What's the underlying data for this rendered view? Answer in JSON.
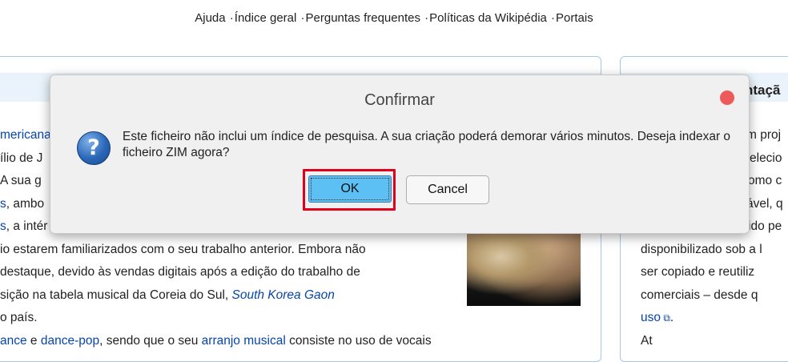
{
  "topnav": {
    "links": [
      "Ajuda",
      "Índice geral",
      "Perguntas frequentes",
      "Políticas da Wikipédia",
      "Portais"
    ],
    "separator": "·"
  },
  "right_box": {
    "heading": "ntaçã",
    "lines": [
      "m proj",
      "elecio",
      "omo c",
      "ável, q",
      "ido pe",
      "disponibilizado sob a l",
      "ser copiado e reutiliz",
      "comerciais – desde q",
      "uso",
      "At"
    ]
  },
  "article": {
    "l1": "mericana",
    "l2": "ílio de J",
    "l3": " A sua g",
    "l4_link": "s",
    "l4_text": ", ambo",
    "l5_link": "s",
    "l5_text": ", a intér",
    "l6": "io estarem familiarizados com o seu trabalho anterior. Embora não",
    "l7": "destaque, devido às vendas digitais após a edição do trabalho de",
    "l8_text": "sição na tabela musical da Coreia do Sul, ",
    "l8_link": "South Korea Gaon",
    "l9": "o país.",
    "l10_link1": "ance",
    "l10_text1": " e ",
    "l10_link2": "dance-pop",
    "l10_text2": ", sendo que o seu ",
    "l10_link3": "arranjo musical",
    "l10_text3": " consiste no uso de vocais"
  },
  "dialog": {
    "title": "Confirmar",
    "message": "Este ficheiro não inclui um índice de pesquisa. A sua criação poderá demorar vários minutos. Deseja indexar o ficheiro ZIM agora?",
    "icon": "question-icon",
    "ok_label": "OK",
    "cancel_label": "Cancel",
    "highlight_color": "#e0001a"
  }
}
